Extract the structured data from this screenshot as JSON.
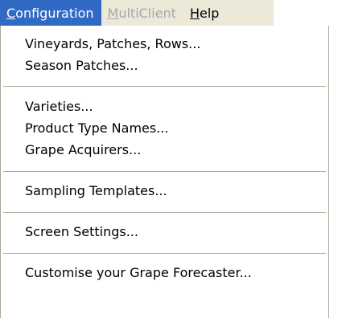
{
  "menubar": {
    "menus": [
      {
        "pre": "",
        "mnemonic": "C",
        "post": "onfiguration",
        "state": "active"
      },
      {
        "pre": "",
        "mnemonic": "M",
        "post": "ultiClient",
        "state": "disabled"
      },
      {
        "pre": "",
        "mnemonic": "H",
        "post": "elp",
        "state": "normal"
      }
    ]
  },
  "dropdown": {
    "items": [
      "Vineyards, Patches, Rows...",
      "Season Patches...",
      "Varieties...",
      "Product Type Names...",
      "Grape Acquirers...",
      "Sampling Templates...",
      "Screen Settings...",
      "Customise your Grape Forecaster..."
    ]
  },
  "colors": {
    "menubar_bg": "#ece9d8",
    "highlight": "#316ac5",
    "disabled_text": "#a7a6aa",
    "separator": "#aca899"
  }
}
